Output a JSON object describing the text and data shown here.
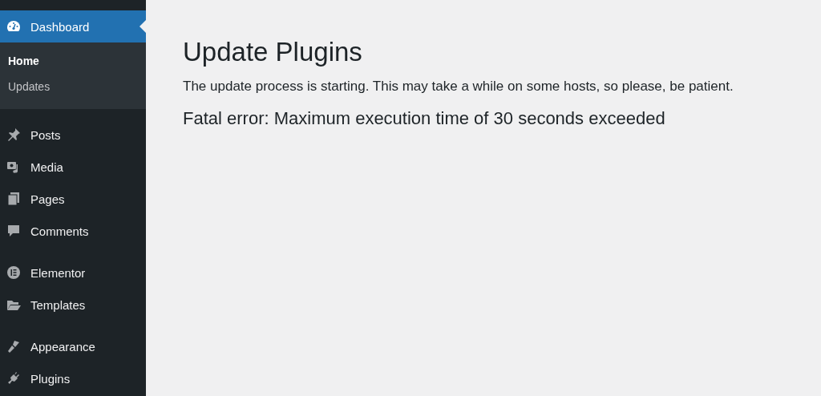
{
  "sidebar": {
    "groups": [
      {
        "items": [
          {
            "label": "Dashboard",
            "selected": true,
            "children": [
              {
                "label": "Home",
                "selected": true
              },
              {
                "label": "Updates",
                "selected": false
              }
            ]
          }
        ]
      },
      {
        "items": [
          {
            "label": "Posts",
            "selected": false
          },
          {
            "label": "Media",
            "selected": false
          },
          {
            "label": "Pages",
            "selected": false
          },
          {
            "label": "Comments",
            "selected": false
          }
        ]
      },
      {
        "items": [
          {
            "label": "Elementor",
            "selected": false
          },
          {
            "label": "Templates",
            "selected": false
          }
        ]
      },
      {
        "items": [
          {
            "label": "Appearance",
            "selected": false
          },
          {
            "label": "Plugins",
            "selected": false
          }
        ]
      }
    ]
  },
  "main": {
    "title": "Update Plugins",
    "message": "The update process is starting. This may take a while on some hosts, so please, be patient.",
    "error": "Fatal error: Maximum execution time of 30 seconds exceeded"
  }
}
